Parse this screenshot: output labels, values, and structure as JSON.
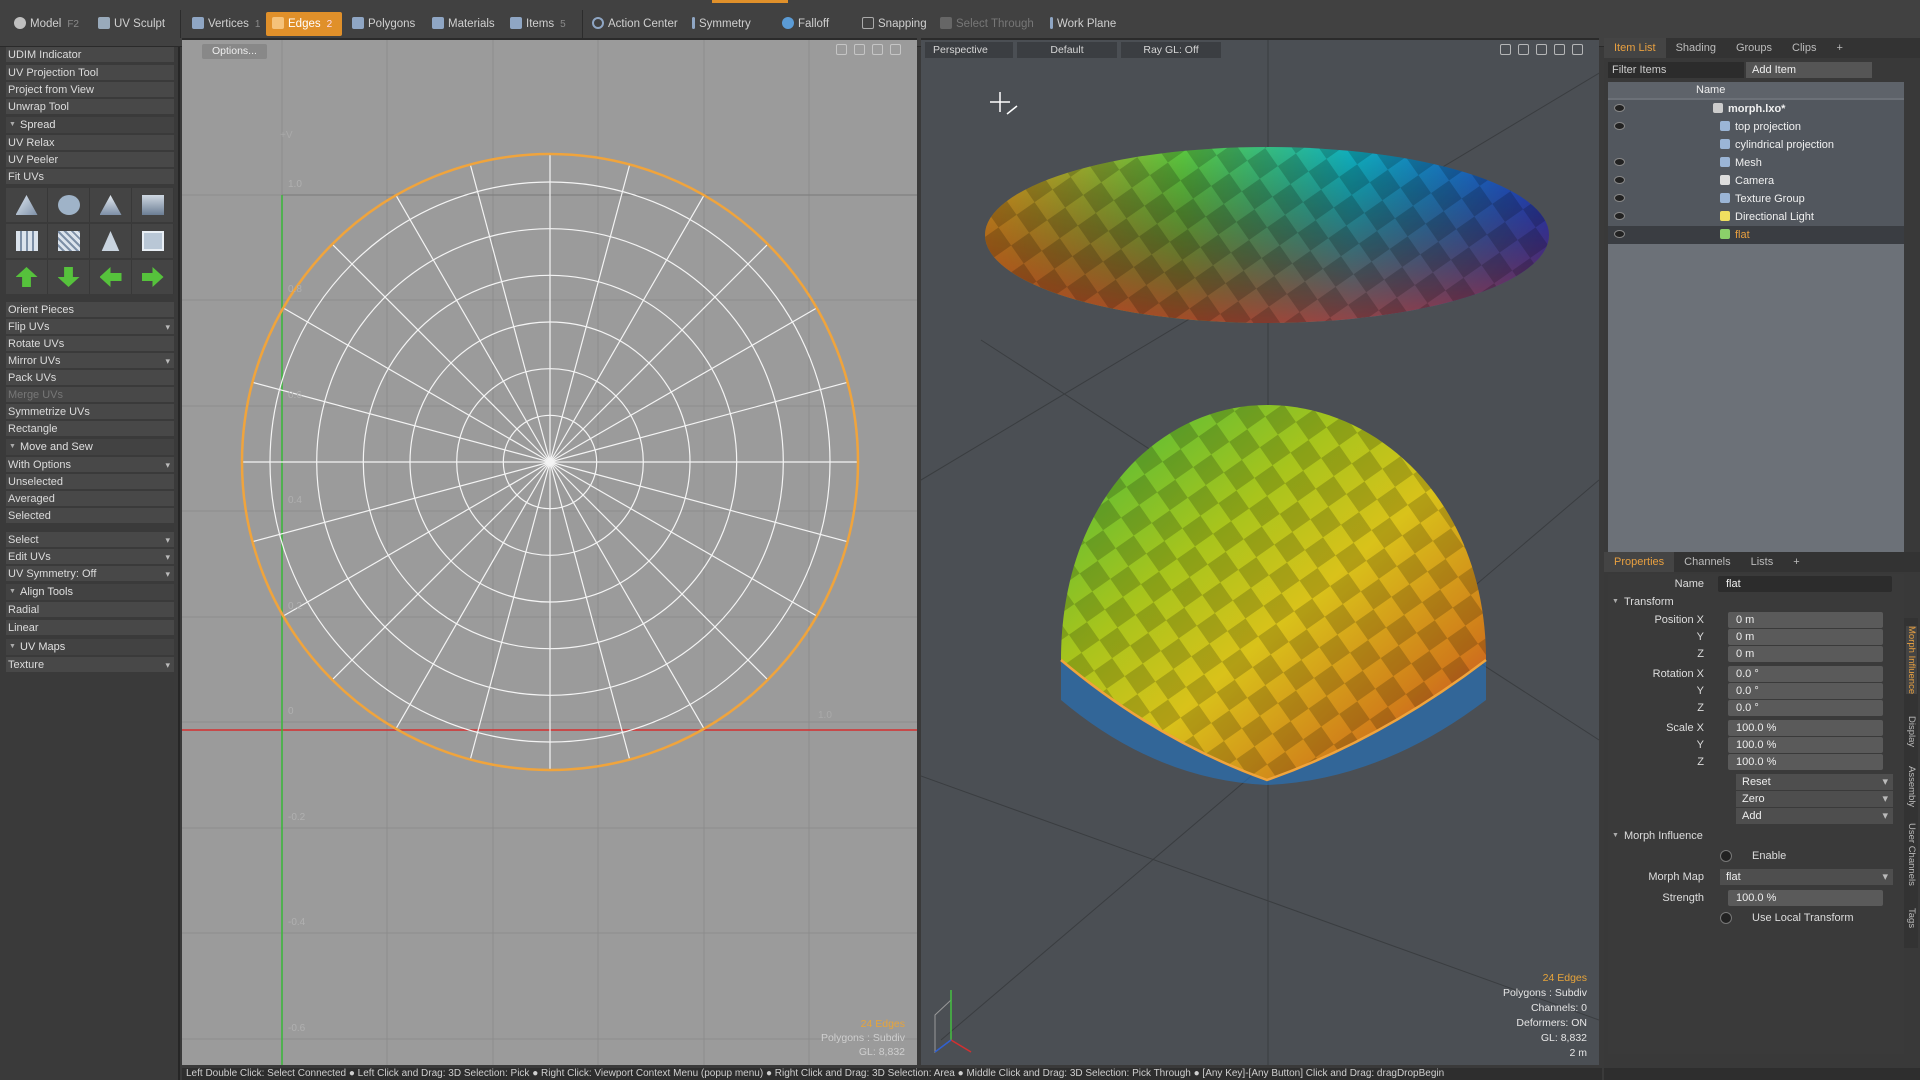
{
  "topbar": {
    "mode_model": "Model",
    "mode_model_key": "F2",
    "mode_uvsculpt": "UV Sculpt",
    "vertices": "Vertices",
    "vertices_key": "1",
    "edges": "Edges",
    "edges_key": "2",
    "polygons": "Polygons",
    "materials": "Materials",
    "items": "Items",
    "items_key": "5",
    "action_center": "Action Center",
    "symmetry": "Symmetry",
    "falloff": "Falloff",
    "snapping": "Snapping",
    "select_through": "Select Through",
    "work_plane": "Work Plane"
  },
  "left": {
    "udim": "UDIM Indicator",
    "uv_projection_tool": "UV Projection Tool",
    "project_from_view": "Project from View",
    "unwrap_tool": "Unwrap Tool",
    "spread": "Spread",
    "uv_relax": "UV Relax",
    "uv_peeler": "UV Peeler",
    "fit_uvs": "Fit UVs",
    "orient_pieces": "Orient Pieces",
    "flip_uvs": "Flip UVs",
    "rotate_uvs": "Rotate UVs",
    "mirror_uvs": "Mirror UVs",
    "pack_uvs": "Pack UVs",
    "merge_uvs": "Merge UVs",
    "symmetrize_uvs": "Symmetrize UVs",
    "rectangle": "Rectangle",
    "move_and_sew": "Move and Sew",
    "with_options": "With Options",
    "unselected": "Unselected",
    "averaged": "Averaged",
    "selected": "Selected",
    "select": "Select",
    "edit_uvs": "Edit UVs",
    "uv_symmetry": "UV Symmetry: Off",
    "align_tools": "Align Tools",
    "radial": "Radial",
    "linear": "Linear",
    "uv_maps": "UV Maps",
    "texture": "Texture"
  },
  "uv": {
    "options": "Options...",
    "axis_v": "+V",
    "ticks_v": [
      "1.0",
      "0.8",
      "0.6",
      "0.4",
      "0.2",
      "0",
      "-0.2",
      "-0.4",
      "-0.6"
    ],
    "tick_u1": "1.0",
    "info_edges": "24 Edges",
    "info_polys": "Polygons : Subdiv",
    "info_gl": "GL: 8,832"
  },
  "view3d": {
    "perspective": "Perspective",
    "default": "Default",
    "raygl": "Ray GL: Off",
    "info_edges": "24 Edges",
    "info_polys": "Polygons : Subdiv",
    "info_channels": "Channels: 0",
    "info_deformers": "Deformers: ON",
    "info_gl": "GL: 8,832",
    "info_scale": "2 m"
  },
  "itemlist": {
    "tabs": [
      "Item List",
      "Shading",
      "Groups",
      "Clips"
    ],
    "filter": "Filter Items",
    "add_item": "Add Item",
    "col_name": "Name",
    "rows": [
      "morph.lxo*",
      "top projection",
      "cylindrical projection",
      "Mesh",
      "Camera",
      "Texture Group",
      "Directional Light",
      "flat"
    ]
  },
  "props": {
    "tabs": [
      "Properties",
      "Channels",
      "Lists"
    ],
    "name_label": "Name",
    "name_value": "flat",
    "transform": "Transform",
    "position_x": "Position X",
    "rotation_x": "Rotation X",
    "scale_x": "Scale X",
    "y": "Y",
    "z": "Z",
    "pos_vals": [
      "0 m",
      "0 m",
      "0 m"
    ],
    "rot_vals": [
      "0.0 °",
      "0.0 °",
      "0.0 °"
    ],
    "scale_vals": [
      "100.0 %",
      "100.0 %",
      "100.0 %"
    ],
    "reset": "Reset",
    "zero": "Zero",
    "add": "Add",
    "morph_influence": "Morph Influence",
    "enable": "Enable",
    "morph_map_label": "Morph Map",
    "morph_map_value": "flat",
    "strength_label": "Strength",
    "strength_value": "100.0 %",
    "use_local": "Use Local Transform",
    "side_tabs": [
      "Morph Influence",
      "Display",
      "Assembly",
      "User Channels",
      "Tags"
    ]
  },
  "status": "Left Double Click: Select Connected ● Left Click and Drag: 3D Selection: Pick ● Right Click: Viewport Context Menu (popup menu) ● Right Click and Drag: 3D Selection: Area ● Middle Click and Drag: 3D Selection: Pick Through ● [Any Key]-[Any Button] Click and Drag: dragDropBegin",
  "colors": {
    "accent": "#e0902a",
    "uv_bg": "#9b9b9b",
    "viewport_bg": "#4b4f54",
    "edge_orange": "#f0a43c"
  }
}
